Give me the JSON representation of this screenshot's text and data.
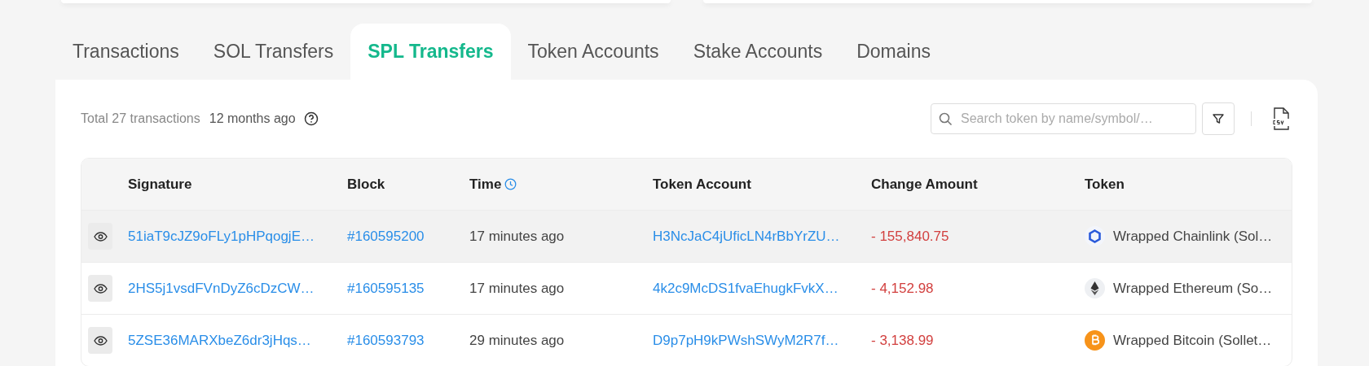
{
  "tabs": [
    {
      "label": "Transactions",
      "selected": false
    },
    {
      "label": "SOL Transfers",
      "selected": false
    },
    {
      "label": "SPL Transfers",
      "selected": true
    },
    {
      "label": "Token Accounts",
      "selected": false
    },
    {
      "label": "Stake Accounts",
      "selected": false
    },
    {
      "label": "Domains",
      "selected": false
    }
  ],
  "summary": {
    "total": "Total 27 transactions",
    "age": "12 months ago"
  },
  "search": {
    "placeholder": "Search token by name/symbol/…"
  },
  "table": {
    "columns": [
      "Signature",
      "Block",
      "Time",
      "Token Account",
      "Change Amount",
      "Token"
    ],
    "rows": [
      {
        "highlighted": true,
        "signature": "51iaT9cJZ9oFLy1pHPqogjE…",
        "block": "#160595200",
        "time": "17 minutes ago",
        "token_account": "H3NcJaC4jUficLN4rBbYrZU…",
        "change_amount": "- 155,840.75",
        "token": {
          "kind": "chainlink",
          "name": "Wrapped Chainlink (Sol…"
        }
      },
      {
        "highlighted": false,
        "signature": "2HS5j1vsdFVnDyZ6cDzCW…",
        "block": "#160595135",
        "time": "17 minutes ago",
        "token_account": "4k2c9McDS1fvaEhugkFvkX…",
        "change_amount": "- 4,152.98",
        "token": {
          "kind": "ethereum",
          "name": "Wrapped Ethereum (So…"
        }
      },
      {
        "highlighted": false,
        "signature": "5ZSE36MARXbeZ6dr3jHqs…",
        "block": "#160593793",
        "time": "29 minutes ago",
        "token_account": "D9p7pH9kPWshSWyM2R7f…",
        "change_amount": "- 3,138.99",
        "token": {
          "kind": "bitcoin",
          "name": "Wrapped Bitcoin (Sollet…"
        }
      }
    ]
  }
}
